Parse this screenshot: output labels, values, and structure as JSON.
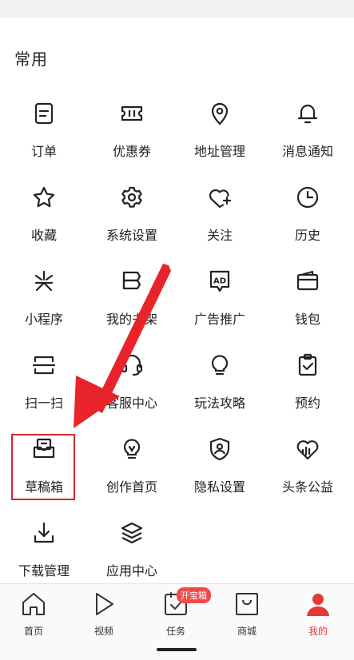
{
  "section": {
    "title": "常用"
  },
  "grid": {
    "items": [
      {
        "label": "订单",
        "icon": "order-icon"
      },
      {
        "label": "优惠券",
        "icon": "coupon-icon"
      },
      {
        "label": "地址管理",
        "icon": "location-pin-icon"
      },
      {
        "label": "消息通知",
        "icon": "bell-icon"
      },
      {
        "label": "收藏",
        "icon": "star-icon"
      },
      {
        "label": "系统设置",
        "icon": "gear-icon"
      },
      {
        "label": "关注",
        "icon": "heart-plus-icon"
      },
      {
        "label": "历史",
        "icon": "clock-icon"
      },
      {
        "label": "小程序",
        "icon": "mini-program-icon"
      },
      {
        "label": "我的书架",
        "icon": "bookshelf-icon"
      },
      {
        "label": "广告推广",
        "icon": "ad-icon"
      },
      {
        "label": "钱包",
        "icon": "wallet-icon"
      },
      {
        "label": "扫一扫",
        "icon": "scan-icon"
      },
      {
        "label": "客服中心",
        "icon": "headset-icon"
      },
      {
        "label": "玩法攻略",
        "icon": "lightbulb-icon"
      },
      {
        "label": "预约",
        "icon": "clipboard-check-icon"
      },
      {
        "label": "草稿箱",
        "icon": "draft-box-icon"
      },
      {
        "label": "创作首页",
        "icon": "creator-bulb-icon"
      },
      {
        "label": "隐私设置",
        "icon": "privacy-shield-icon"
      },
      {
        "label": "头条公益",
        "icon": "charity-heart-icon"
      },
      {
        "label": "下载管理",
        "icon": "download-icon"
      },
      {
        "label": "应用中心",
        "icon": "layers-icon"
      }
    ]
  },
  "tabbar": {
    "tabs": [
      {
        "label": "首页",
        "icon": "home-icon"
      },
      {
        "label": "视频",
        "icon": "play-icon"
      },
      {
        "label": "任务",
        "icon": "task-icon",
        "badge": "开宝箱"
      },
      {
        "label": "商城",
        "icon": "shopping-bag-icon"
      },
      {
        "label": "我的",
        "icon": "profile-icon",
        "active": true
      }
    ]
  },
  "colors": {
    "accent": "#e53935",
    "highlight": "#d9262c",
    "arrow": "#e8242a"
  }
}
